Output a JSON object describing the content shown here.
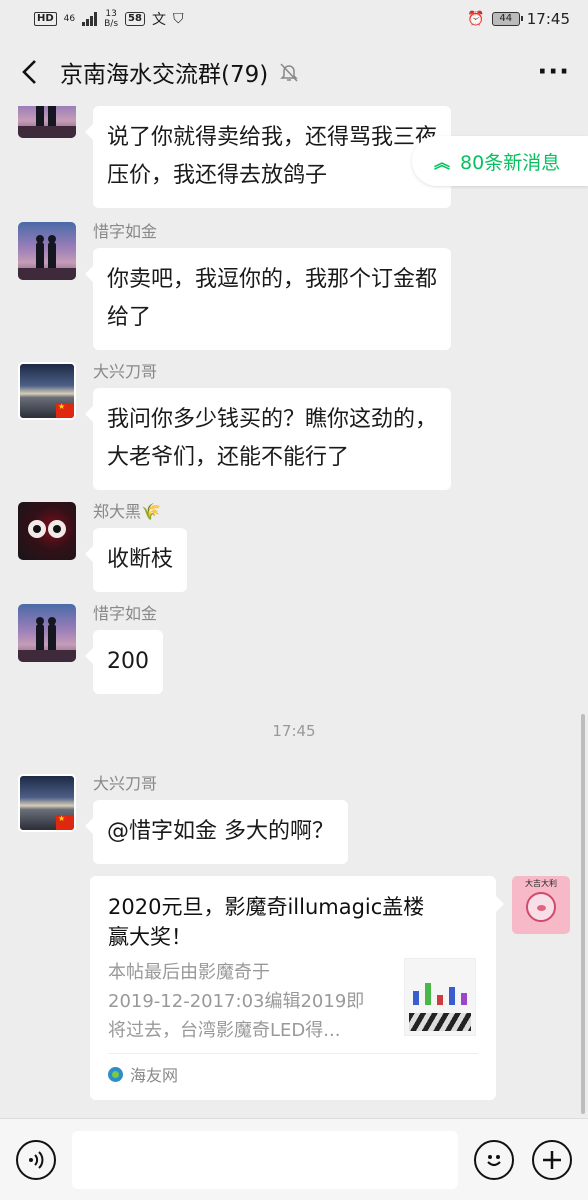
{
  "status_bar": {
    "hd_label": "HD",
    "network": "46",
    "speed_value": "13",
    "speed_unit": "B/s",
    "app_badge": "58",
    "battery": "44",
    "time": "17:45"
  },
  "header": {
    "title": "京南海水交流群(79)",
    "more_label": "···"
  },
  "new_messages": {
    "label": "80条新消息",
    "accent": "#07c160"
  },
  "messages": [
    {
      "sender": "",
      "text_lines": [
        "说了你就得卖给我，还得骂我三夜",
        "压价，我还得去放鸽子"
      ]
    },
    {
      "sender": "惜字如金",
      "text_lines": [
        "你卖吧，我逗你的，我那个订金都",
        "给了"
      ]
    },
    {
      "sender": "大兴刀哥",
      "text_lines": [
        "我问你多少钱买的？瞧你这劲的，",
        "大老爷们，还能不能行了"
      ]
    },
    {
      "sender": "郑大黑🌾",
      "text_lines": [
        "收断枝"
      ]
    },
    {
      "sender": "惜字如金",
      "text_lines": [
        "200"
      ]
    },
    {
      "sender": "大兴刀哥",
      "text_lines": [
        "@惜字如金  多大的啊？"
      ]
    }
  ],
  "time_divider": "17:45",
  "link_card": {
    "title_lines": [
      "2020元旦，影魔奇illumagic盖楼",
      "赢大奖！"
    ],
    "desc_lines": [
      "本帖最后由影魔奇于",
      "2019-12-2017:03编辑2019即",
      "将过去，台湾影魔奇LED得..."
    ],
    "source": "海友网"
  },
  "my_avatar_caption": "大吉大利",
  "input": {
    "placeholder": ""
  }
}
